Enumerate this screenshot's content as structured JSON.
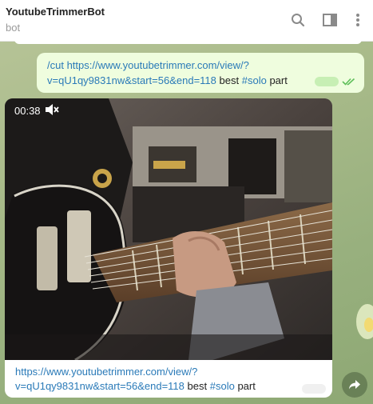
{
  "header": {
    "title": "YoutubeTrimmerBot",
    "subtitle": "bot",
    "icons": [
      "search-icon",
      "sidebar-toggle-icon",
      "more-vertical-icon"
    ]
  },
  "outgoing_message": {
    "command_link": "/cut https://www.youtubetrimmer.com/view/?",
    "link_line2": "v=qU1qy9831nw&start=56&end=118",
    "text_best": "best",
    "hashtag": "#solo",
    "text_part": "part",
    "status": "read",
    "status_icon": "double-check-icon"
  },
  "incoming_message": {
    "video_duration": "00:38",
    "video_muted_icon": "muted-speaker-icon",
    "caption_link_line1": "https://www.youtubetrimmer.com/view/?",
    "caption_link_line2": "v=qU1qy9831nw&start=56&end=118",
    "caption_best": "best",
    "caption_hashtag": "#solo",
    "caption_part": "part"
  },
  "actions": {
    "forward_icon": "forward-arrow-icon"
  },
  "colors": {
    "link": "#2a7ab8",
    "outgoing_bubble": "#effdde",
    "read_check": "#5fbf5a"
  }
}
